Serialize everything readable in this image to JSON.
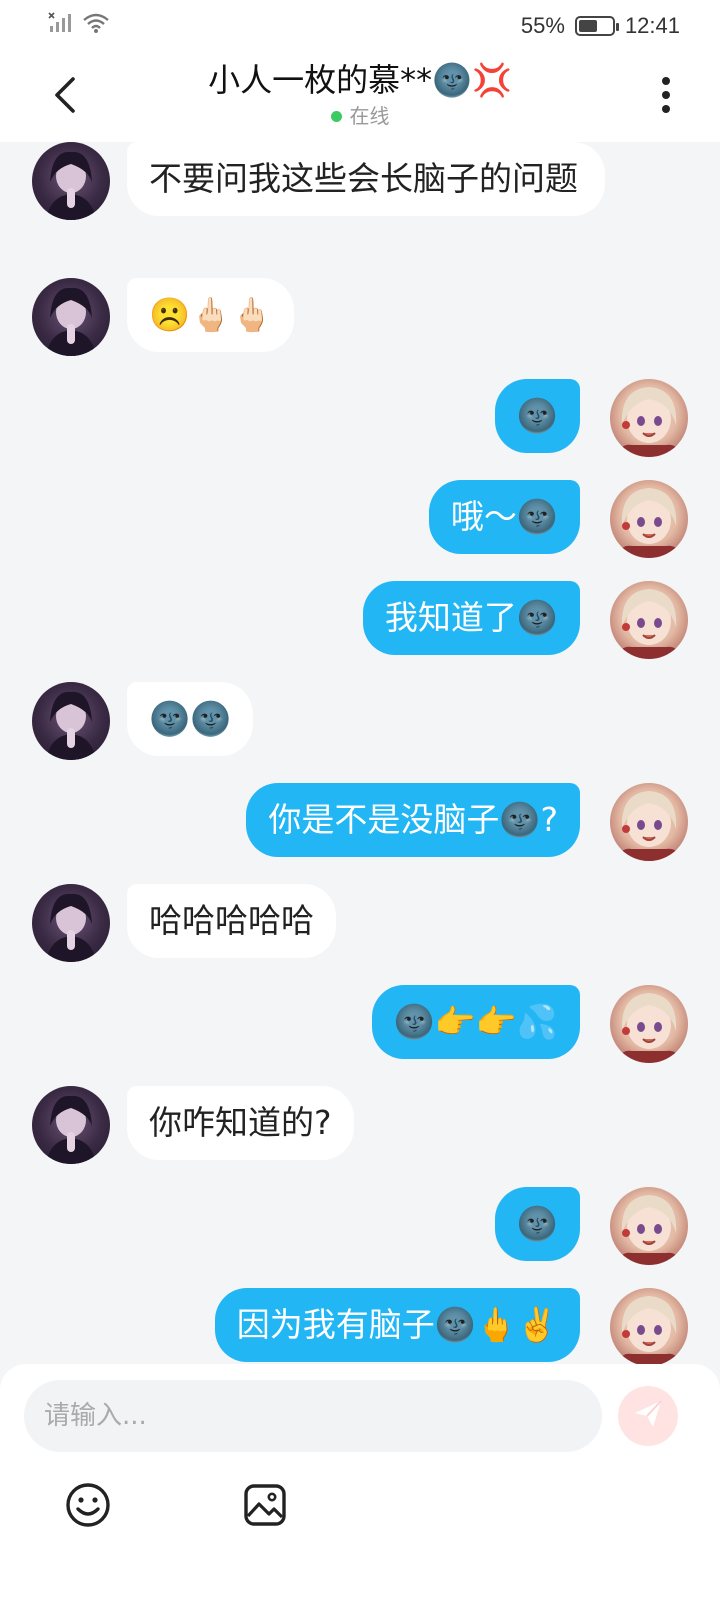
{
  "status_bar": {
    "battery_percent": "55%",
    "battery_level": 0.55,
    "time": "12:41",
    "icons": [
      "cellular-signal-icon",
      "wifi-icon",
      "battery-icon"
    ]
  },
  "header": {
    "contact_name": "小人一枚的慕**🌚💢",
    "online_status": "在线",
    "online_color": "#3ccb63",
    "icons": [
      "back-arrow-icon",
      "more-options-icon"
    ]
  },
  "messages": [
    {
      "side": "left",
      "text": "不要问我这些会长脑子的问题"
    },
    {
      "side": "left",
      "text": "☹️🖕🏻🖕🏻"
    },
    {
      "side": "right",
      "text": "🌚"
    },
    {
      "side": "right",
      "text": "哦～🌚"
    },
    {
      "side": "right",
      "text": "我知道了🌚"
    },
    {
      "side": "left",
      "text": "🌚🌚"
    },
    {
      "side": "right",
      "text": "你是不是没脑子🌚?"
    },
    {
      "side": "left",
      "text": "哈哈哈哈哈"
    },
    {
      "side": "right",
      "text": "🌚👉👉💦"
    },
    {
      "side": "left",
      "text": "你咋知道的?"
    },
    {
      "side": "right",
      "text": "🌚"
    },
    {
      "side": "right",
      "text": "因为我有脑子🌚🖕✌️"
    }
  ],
  "composer": {
    "placeholder": "请输入...",
    "icons": [
      "send-icon",
      "emoji-icon",
      "image-icon"
    ]
  },
  "colors": {
    "sent_bubble": "#22b6f5",
    "received_bubble": "#ffffff",
    "background": "#f4f5f7"
  }
}
